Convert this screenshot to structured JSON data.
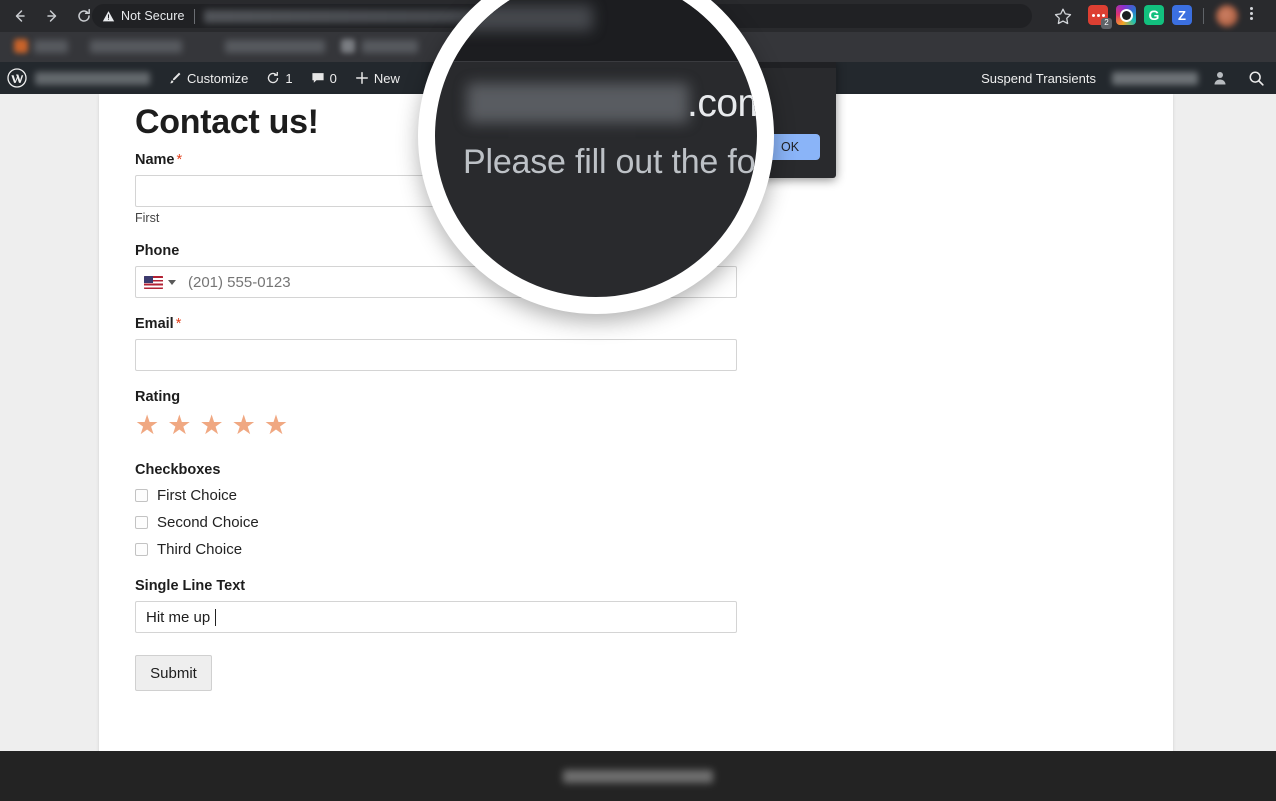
{
  "browser": {
    "back_icon": "back-arrow-icon",
    "forward_icon": "forward-arrow-icon",
    "reload_icon": "reload-icon",
    "security_label": "Not Secure",
    "url_value": "",
    "url_placeholder": "",
    "bookmark_star_icon": "star-icon",
    "menu_icon": "kebab-menu-icon",
    "extensions": [
      {
        "name": "extension-red-dots",
        "badge": "2"
      },
      {
        "name": "extension-colorful-ring",
        "badge": ""
      },
      {
        "name": "extension-grammarly",
        "label": "G",
        "badge": ""
      },
      {
        "name": "extension-zotero",
        "label": "Z",
        "badge": ""
      }
    ]
  },
  "wp_adminbar": {
    "logo_icon": "wordpress-logo-icon",
    "site_name": "",
    "customize_label": "Customize",
    "customize_icon": "paintbrush-icon",
    "updates_icon": "updates-icon",
    "updates_count": "1",
    "comments_icon": "comment-bubble-icon",
    "comments_count": "0",
    "new_icon": "plus-icon",
    "new_label": "New",
    "suspend_transients_label": "Suspend Transients",
    "user_name": "",
    "account_icon": "user-avatar-icon",
    "search_icon": "search-icon"
  },
  "page": {
    "title": "Contact us!",
    "footer_text": ""
  },
  "form": {
    "name": {
      "label": "Name",
      "required_mark": "*",
      "value": "",
      "sub_label": "First"
    },
    "phone": {
      "label": "Phone",
      "country_flag": "us-flag-icon",
      "country_caret": "chevron-down-icon",
      "placeholder": "(201) 555-0123",
      "value": ""
    },
    "email": {
      "label": "Email",
      "required_mark": "*",
      "value": ""
    },
    "rating": {
      "label": "Rating",
      "star_icon": "star-icon",
      "stars": [
        "★",
        "★",
        "★",
        "★",
        "★"
      ],
      "selected": 0,
      "star_color": "#f0a882"
    },
    "checkboxes": {
      "label": "Checkboxes",
      "options": [
        {
          "label": "First Choice",
          "checked": false
        },
        {
          "label": "Second Choice",
          "checked": false
        },
        {
          "label": "Third Choice",
          "checked": false
        }
      ]
    },
    "single_line_text": {
      "label": "Single Line Text",
      "value": "Hit me up"
    },
    "submit_label": "Submit"
  },
  "alert_dialog": {
    "origin_redacted": "",
    "origin_tld": ".com",
    "message": "Please fill out the form",
    "ok_label": "OK"
  },
  "magnifier": {
    "origin_tld": ".com",
    "message": "Please fill out the form"
  },
  "colors": {
    "chrome_toolbar": "#292a2d",
    "bookmarks_bar": "#35363a",
    "wp_adminbar": "#23282d",
    "dialog_bg": "#292a2d",
    "ok_button": "#8ab4f8",
    "star": "#f0a882",
    "required": "#e2401c",
    "footer": "#232323"
  }
}
